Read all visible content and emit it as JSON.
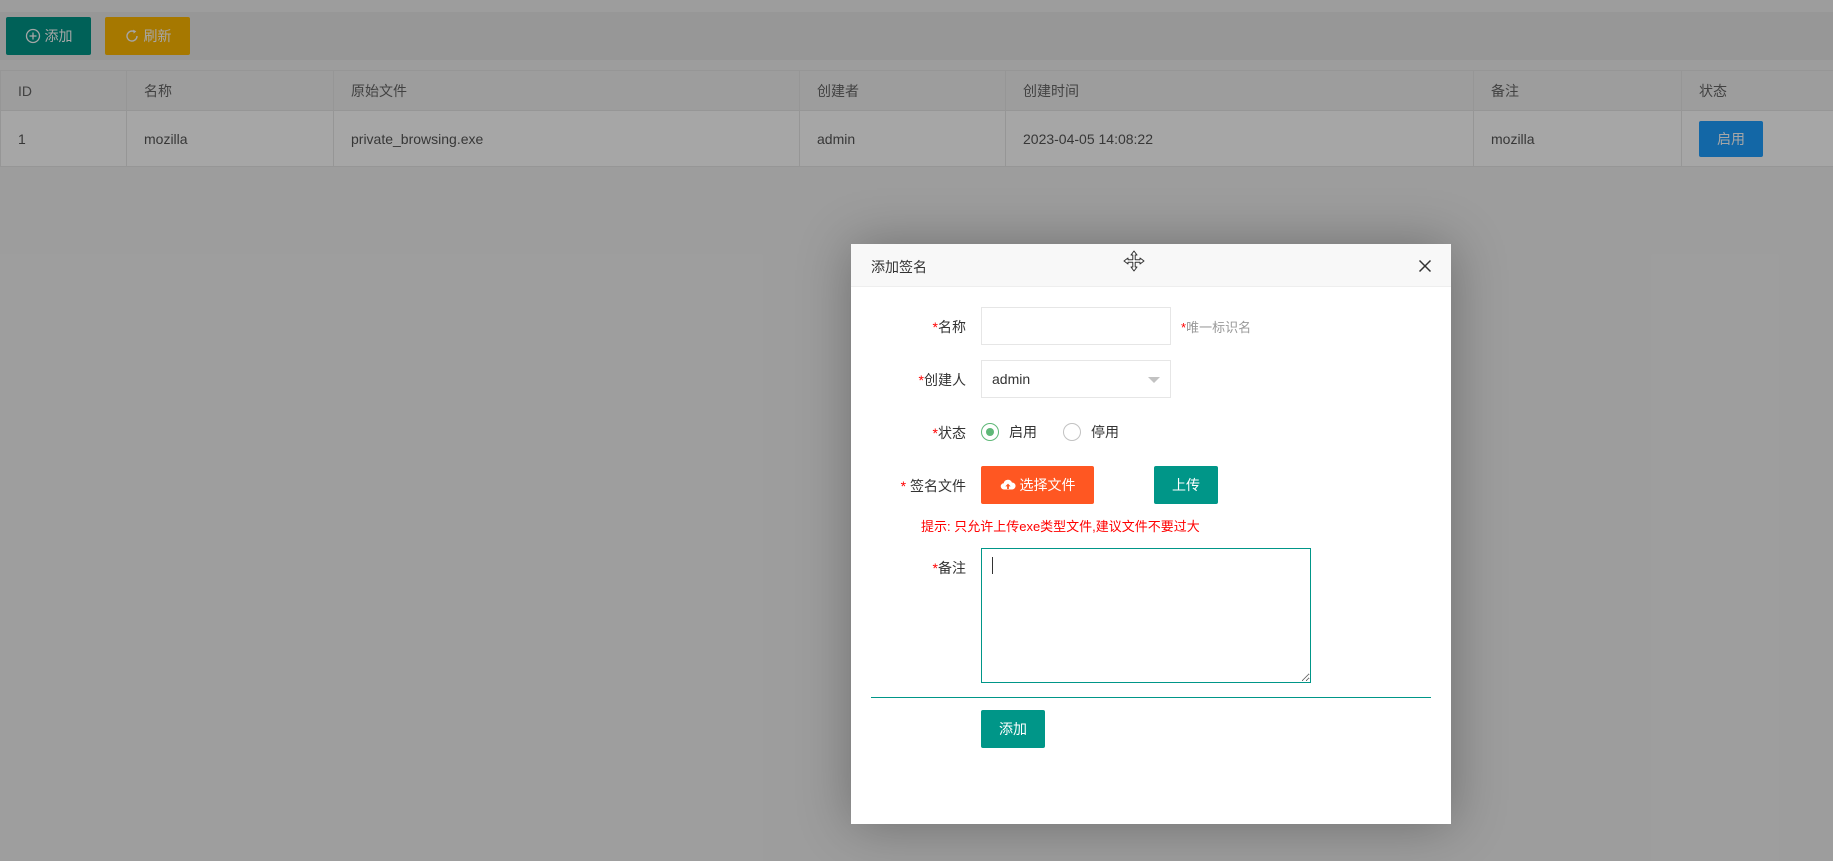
{
  "toolbar": {
    "add_label": "添加",
    "refresh_label": "刷新"
  },
  "table": {
    "columns": [
      "ID",
      "名称",
      "原始文件",
      "创建者",
      "创建时间",
      "备注",
      "状态"
    ],
    "rows": [
      {
        "id": "1",
        "name": "mozilla",
        "original_file": "private_browsing.exe",
        "creator": "admin",
        "created_at": "2023-04-05 14:08:22",
        "remark": "mozilla",
        "status": "启用"
      }
    ]
  },
  "dialog": {
    "title": "添加签名",
    "required_mark": "*",
    "name_label": "名称",
    "name_value": "",
    "name_hint": "唯一标识名",
    "creator_label": "创建人",
    "creator_value": "admin",
    "status_label": "状态",
    "status_options": [
      "启用",
      "停用"
    ],
    "status_selected": "启用",
    "file_label": "签名文件",
    "choose_file_label": "选择文件",
    "upload_label": "上传",
    "tip": "提示: 只允许上传exe类型文件,建议文件不要过大",
    "remark_label": "备注",
    "remark_value": "",
    "submit_label": "添加"
  },
  "colors": {
    "primary": "#009688",
    "warm": "#ffb800",
    "danger": "#ff5722",
    "normal": "#1e9fff",
    "radio_checked": "#5fb878",
    "required": "#ff0000"
  },
  "icons": {
    "add": "plus-circle-icon",
    "refresh": "refresh-icon",
    "move": "move-icon",
    "close": "close-icon",
    "upload": "cloud-upload-icon"
  }
}
